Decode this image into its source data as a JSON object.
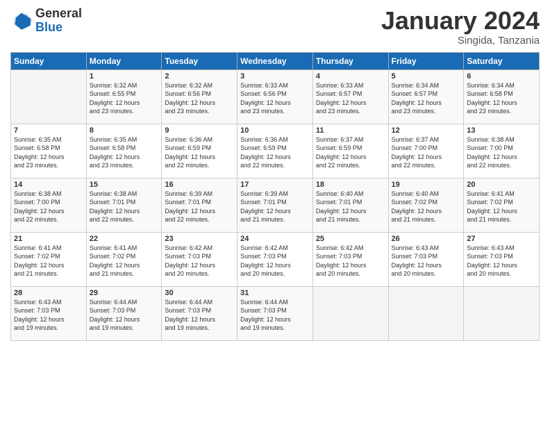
{
  "header": {
    "logo_general": "General",
    "logo_blue": "Blue",
    "month_title": "January 2024",
    "location": "Singida, Tanzania"
  },
  "weekdays": [
    "Sunday",
    "Monday",
    "Tuesday",
    "Wednesday",
    "Thursday",
    "Friday",
    "Saturday"
  ],
  "weeks": [
    [
      {
        "day": "",
        "info": ""
      },
      {
        "day": "1",
        "info": "Sunrise: 6:32 AM\nSunset: 6:55 PM\nDaylight: 12 hours\nand 23 minutes."
      },
      {
        "day": "2",
        "info": "Sunrise: 6:32 AM\nSunset: 6:56 PM\nDaylight: 12 hours\nand 23 minutes."
      },
      {
        "day": "3",
        "info": "Sunrise: 6:33 AM\nSunset: 6:56 PM\nDaylight: 12 hours\nand 23 minutes."
      },
      {
        "day": "4",
        "info": "Sunrise: 6:33 AM\nSunset: 6:57 PM\nDaylight: 12 hours\nand 23 minutes."
      },
      {
        "day": "5",
        "info": "Sunrise: 6:34 AM\nSunset: 6:57 PM\nDaylight: 12 hours\nand 23 minutes."
      },
      {
        "day": "6",
        "info": "Sunrise: 6:34 AM\nSunset: 6:58 PM\nDaylight: 12 hours\nand 23 minutes."
      }
    ],
    [
      {
        "day": "7",
        "info": "Sunrise: 6:35 AM\nSunset: 6:58 PM\nDaylight: 12 hours\nand 23 minutes."
      },
      {
        "day": "8",
        "info": "Sunrise: 6:35 AM\nSunset: 6:58 PM\nDaylight: 12 hours\nand 23 minutes."
      },
      {
        "day": "9",
        "info": "Sunrise: 6:36 AM\nSunset: 6:59 PM\nDaylight: 12 hours\nand 22 minutes."
      },
      {
        "day": "10",
        "info": "Sunrise: 6:36 AM\nSunset: 6:59 PM\nDaylight: 12 hours\nand 22 minutes."
      },
      {
        "day": "11",
        "info": "Sunrise: 6:37 AM\nSunset: 6:59 PM\nDaylight: 12 hours\nand 22 minutes."
      },
      {
        "day": "12",
        "info": "Sunrise: 6:37 AM\nSunset: 7:00 PM\nDaylight: 12 hours\nand 22 minutes."
      },
      {
        "day": "13",
        "info": "Sunrise: 6:38 AM\nSunset: 7:00 PM\nDaylight: 12 hours\nand 22 minutes."
      }
    ],
    [
      {
        "day": "14",
        "info": "Sunrise: 6:38 AM\nSunset: 7:00 PM\nDaylight: 12 hours\nand 22 minutes."
      },
      {
        "day": "15",
        "info": "Sunrise: 6:38 AM\nSunset: 7:01 PM\nDaylight: 12 hours\nand 22 minutes."
      },
      {
        "day": "16",
        "info": "Sunrise: 6:39 AM\nSunset: 7:01 PM\nDaylight: 12 hours\nand 22 minutes."
      },
      {
        "day": "17",
        "info": "Sunrise: 6:39 AM\nSunset: 7:01 PM\nDaylight: 12 hours\nand 21 minutes."
      },
      {
        "day": "18",
        "info": "Sunrise: 6:40 AM\nSunset: 7:01 PM\nDaylight: 12 hours\nand 21 minutes."
      },
      {
        "day": "19",
        "info": "Sunrise: 6:40 AM\nSunset: 7:02 PM\nDaylight: 12 hours\nand 21 minutes."
      },
      {
        "day": "20",
        "info": "Sunrise: 6:41 AM\nSunset: 7:02 PM\nDaylight: 12 hours\nand 21 minutes."
      }
    ],
    [
      {
        "day": "21",
        "info": "Sunrise: 6:41 AM\nSunset: 7:02 PM\nDaylight: 12 hours\nand 21 minutes."
      },
      {
        "day": "22",
        "info": "Sunrise: 6:41 AM\nSunset: 7:02 PM\nDaylight: 12 hours\nand 21 minutes."
      },
      {
        "day": "23",
        "info": "Sunrise: 6:42 AM\nSunset: 7:03 PM\nDaylight: 12 hours\nand 20 minutes."
      },
      {
        "day": "24",
        "info": "Sunrise: 6:42 AM\nSunset: 7:03 PM\nDaylight: 12 hours\nand 20 minutes."
      },
      {
        "day": "25",
        "info": "Sunrise: 6:42 AM\nSunset: 7:03 PM\nDaylight: 12 hours\nand 20 minutes."
      },
      {
        "day": "26",
        "info": "Sunrise: 6:43 AM\nSunset: 7:03 PM\nDaylight: 12 hours\nand 20 minutes."
      },
      {
        "day": "27",
        "info": "Sunrise: 6:43 AM\nSunset: 7:03 PM\nDaylight: 12 hours\nand 20 minutes."
      }
    ],
    [
      {
        "day": "28",
        "info": "Sunrise: 6:43 AM\nSunset: 7:03 PM\nDaylight: 12 hours\nand 19 minutes."
      },
      {
        "day": "29",
        "info": "Sunrise: 6:44 AM\nSunset: 7:03 PM\nDaylight: 12 hours\nand 19 minutes."
      },
      {
        "day": "30",
        "info": "Sunrise: 6:44 AM\nSunset: 7:03 PM\nDaylight: 12 hours\nand 19 minutes."
      },
      {
        "day": "31",
        "info": "Sunrise: 6:44 AM\nSunset: 7:03 PM\nDaylight: 12 hours\nand 19 minutes."
      },
      {
        "day": "",
        "info": ""
      },
      {
        "day": "",
        "info": ""
      },
      {
        "day": "",
        "info": ""
      }
    ]
  ]
}
